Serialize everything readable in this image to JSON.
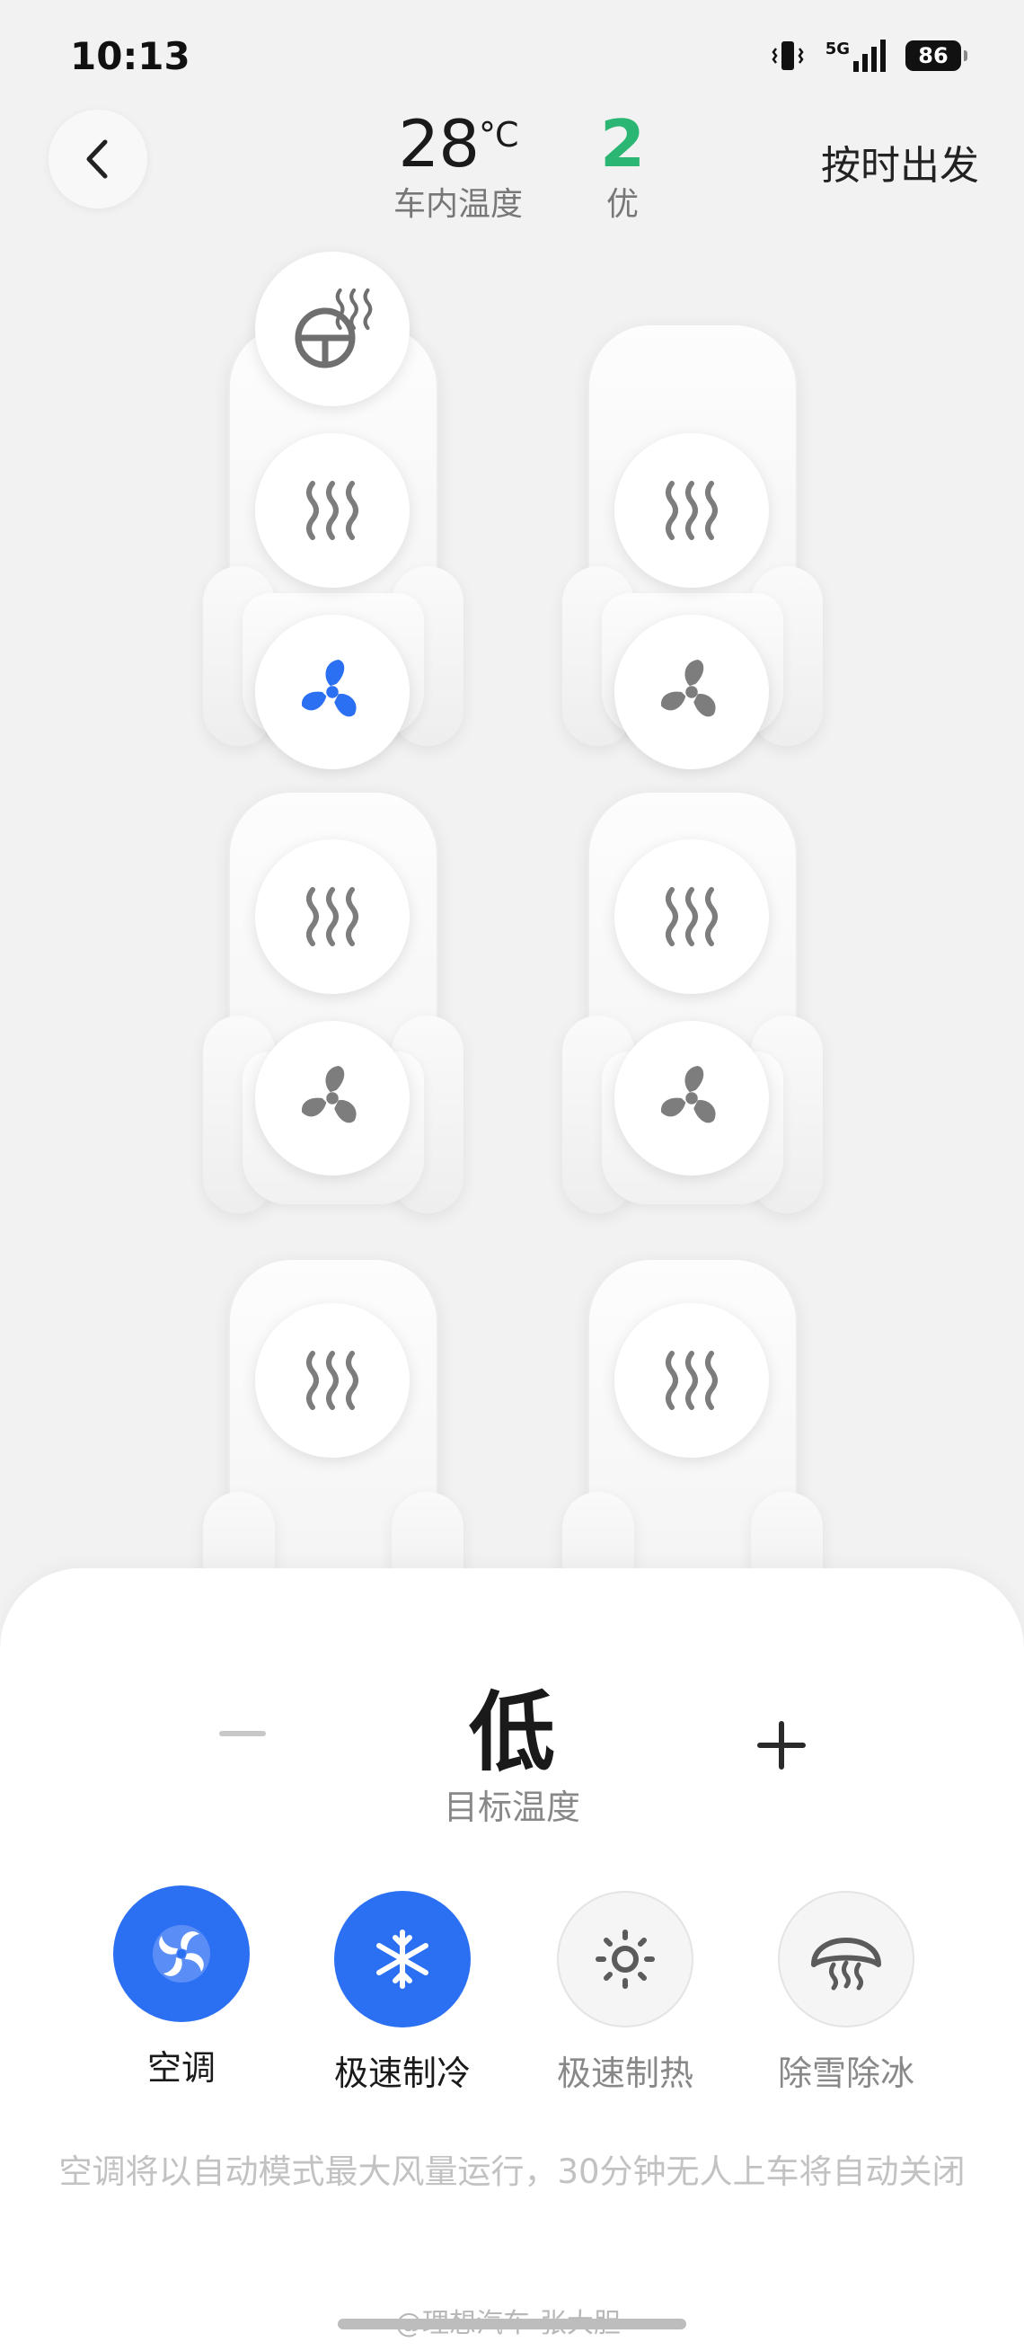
{
  "status_bar": {
    "time": "10:13",
    "network": "5G",
    "battery": "86"
  },
  "header": {
    "temperature_value": "28",
    "temperature_unit": "°C",
    "temperature_label": "车内温度",
    "air_quality_value": "2",
    "air_quality_label": "优",
    "depart_button": "按时出发"
  },
  "seats": {
    "front_left": {
      "steering_wheel_heat": "off",
      "seat_heat": "off",
      "seat_ventilation": "on"
    },
    "front_right": {
      "seat_heat": "off",
      "seat_ventilation": "off"
    },
    "middle_left": {
      "seat_heat": "off",
      "seat_ventilation": "off"
    },
    "middle_right": {
      "seat_heat": "off",
      "seat_ventilation": "off"
    },
    "rear_left": {
      "seat_heat": "off"
    },
    "rear_right": {
      "seat_heat": "off"
    }
  },
  "control": {
    "target_value": "低",
    "target_label": "目标温度"
  },
  "modes": [
    {
      "label": "空调",
      "icon": "ac-fan-icon",
      "active": true
    },
    {
      "label": "极速制冷",
      "icon": "snowflake-icon",
      "active": true
    },
    {
      "label": "极速制热",
      "icon": "sun-icon",
      "active": false
    },
    {
      "label": "除雪除冰",
      "icon": "defrost-icon",
      "active": false
    }
  ],
  "hint": "空调将以自动模式最大风量运行，30分钟无人上车将自动关闭",
  "watermark": "@理想汽车-张大胆",
  "colors": {
    "accent": "#2b6ff3",
    "air_quality_good": "#2bb673",
    "icon_gray": "#7d7d7d"
  }
}
